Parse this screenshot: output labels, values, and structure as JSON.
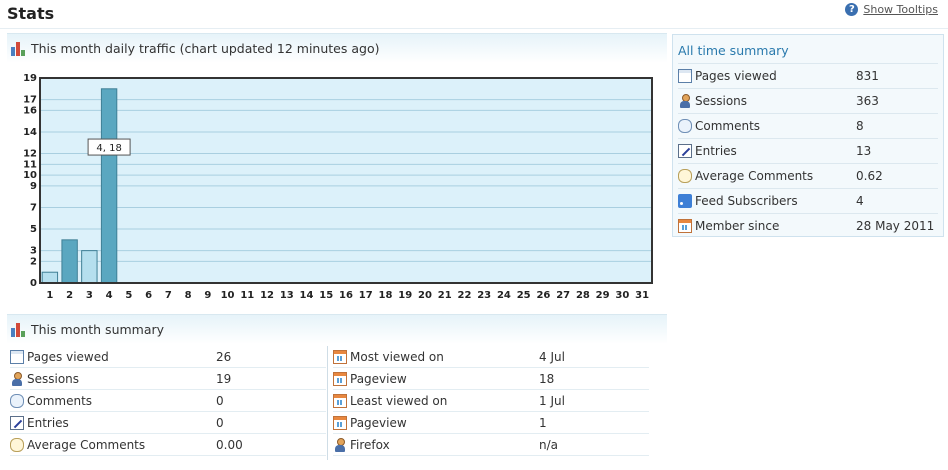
{
  "page": {
    "title": "Stats",
    "tooltip_label": "Show Tooltips"
  },
  "traffic": {
    "title": "This month daily traffic (chart updated 12 minutes ago)",
    "tooltip_text": "4, 18"
  },
  "chart_data": {
    "type": "bar",
    "categories": [
      "1",
      "2",
      "3",
      "4",
      "5",
      "6",
      "7",
      "8",
      "9",
      "10",
      "11",
      "12",
      "13",
      "14",
      "15",
      "16",
      "17",
      "18",
      "19",
      "20",
      "21",
      "22",
      "23",
      "24",
      "25",
      "26",
      "27",
      "28",
      "29",
      "30",
      "31"
    ],
    "series": [
      {
        "values": [
          1,
          4,
          3,
          18,
          0,
          0,
          0,
          0,
          0,
          0,
          0,
          0,
          0,
          0,
          0,
          0,
          0,
          0,
          0,
          0,
          0,
          0,
          0,
          0,
          0,
          0,
          0,
          0,
          0,
          0,
          0
        ]
      }
    ],
    "y_ticks": [
      "19",
      "17",
      "16",
      "14",
      "12",
      "11",
      "10",
      "9",
      "7",
      "5",
      "3",
      "2",
      "0"
    ],
    "ylim": [
      0,
      19
    ],
    "highlight": {
      "x": "4",
      "y": 18
    },
    "bar_colors": [
      "#b5dfee",
      "#5aa7c0",
      "#b5dfee",
      "#5aa7c0"
    ],
    "plot_background": "#dcf1fa",
    "grid": true
  },
  "alltime": {
    "title": "All time summary",
    "rows": [
      {
        "label": "Pages viewed",
        "value": "831",
        "icon": "page-icon"
      },
      {
        "label": "Sessions",
        "value": "363",
        "icon": "user-icon"
      },
      {
        "label": "Comments",
        "value": "8",
        "icon": "comment-icon"
      },
      {
        "label": "Entries",
        "value": "13",
        "icon": "edit-icon"
      },
      {
        "label": "Average Comments",
        "value": "0.62",
        "icon": "average-comment-icon"
      },
      {
        "label": "Feed Subscribers",
        "value": "4",
        "icon": "rss-icon"
      },
      {
        "label": "Member since",
        "value": "28 May 2011",
        "icon": "calendar-icon"
      }
    ]
  },
  "month": {
    "title": "This month summary",
    "left": [
      {
        "label": "Pages viewed",
        "value": "26",
        "icon": "page-icon"
      },
      {
        "label": "Sessions",
        "value": "19",
        "icon": "user-icon"
      },
      {
        "label": "Comments",
        "value": "0",
        "icon": "comment-icon"
      },
      {
        "label": "Entries",
        "value": "0",
        "icon": "edit-icon"
      },
      {
        "label": "Average Comments",
        "value": "0.00",
        "icon": "average-comment-icon"
      }
    ],
    "right": [
      {
        "label": "Most viewed on",
        "value": "4 Jul",
        "icon": "calendar-icon"
      },
      {
        "label": "Pageview",
        "value": "18",
        "icon": "calendar-icon"
      },
      {
        "label": "Least viewed on",
        "value": "1 Jul",
        "icon": "calendar-icon"
      },
      {
        "label": "Pageview",
        "value": "1",
        "icon": "calendar-icon"
      },
      {
        "label": "Firefox",
        "value": "n/a",
        "icon": "user-icon"
      }
    ]
  }
}
